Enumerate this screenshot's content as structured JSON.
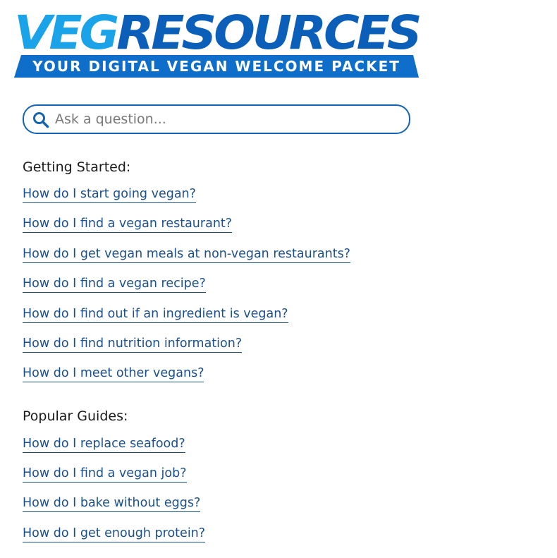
{
  "logo": {
    "part1": "VEG",
    "part2": "RESOURCES",
    "tagline": "YOUR DIGITAL VEGAN WELCOME PACKET",
    "colors": {
      "veg": "#1aa3e8",
      "resources": "#0b5fb8",
      "banner": "#0f6ec9"
    }
  },
  "search": {
    "placeholder": "Ask a question...",
    "value": "",
    "icon": "search-icon",
    "border_color": "#1464b4"
  },
  "getting_started": {
    "heading": "Getting Started:",
    "links": [
      "How do I start going vegan?",
      "How do I find a vegan restaurant?",
      "How do I get vegan meals at non-vegan restaurants?",
      "How do I find a vegan recipe?",
      "How do I find out if an ingredient is vegan?",
      "How do I find nutrition information?",
      "How do I meet other vegans?"
    ]
  },
  "popular_guides": {
    "heading": "Popular Guides:",
    "links": [
      "How do I replace seafood?",
      "How do I find a vegan job?",
      "How do I bake without eggs?",
      "How do I get enough protein?"
    ]
  },
  "colors": {
    "link": "#1b4f8a",
    "heading": "#1a1a1a"
  }
}
